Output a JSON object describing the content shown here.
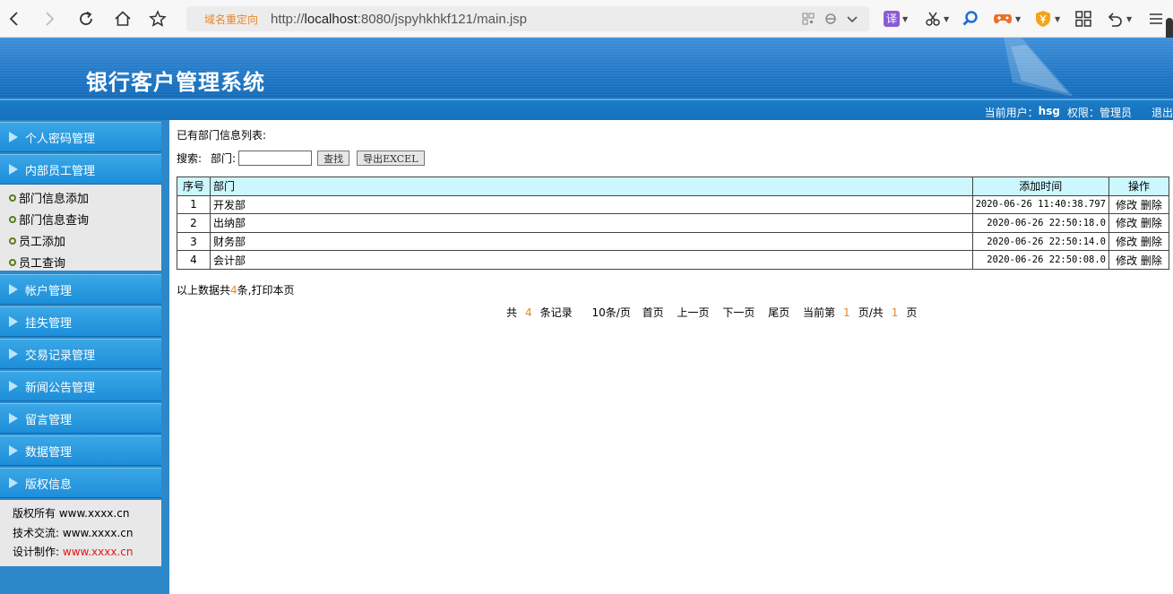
{
  "browser": {
    "redirect_label": "域名重定向",
    "url_prefix": "http://",
    "url_host": "localhost",
    "url_rest": ":8080/jspyhkhkf121/main.jsp",
    "translate_label": "译"
  },
  "header": {
    "title": "银行客户管理系统",
    "current_user_label": "当前用户：",
    "current_user": "hsg",
    "role_label": "权限：",
    "role": "管理员",
    "logout": "退出"
  },
  "sidebar": {
    "menus": [
      {
        "label": "个人密码管理"
      },
      {
        "label": "内部员工管理"
      },
      {
        "label": "帐户管理"
      },
      {
        "label": "挂失管理"
      },
      {
        "label": "交易记录管理"
      },
      {
        "label": "新闻公告管理"
      },
      {
        "label": "留言管理"
      },
      {
        "label": "数据管理"
      },
      {
        "label": "版权信息"
      }
    ],
    "submenu": [
      {
        "label": "部门信息添加"
      },
      {
        "label": "部门信息查询"
      },
      {
        "label": "员工添加"
      },
      {
        "label": "员工查询"
      }
    ],
    "footer": {
      "copyright_label": "版权所有",
      "copyright_value": "www.xxxx.cn",
      "tech_label": "技术交流:",
      "tech_value": "www.xxxx.cn",
      "design_label": "设计制作:",
      "design_value": "www.xxxx.cn"
    }
  },
  "main": {
    "list_title": "已有部门信息列表:",
    "search_label": "搜索:",
    "dept_label": "部门:",
    "dept_value": "",
    "search_button": "查找",
    "export_button": "导出EXCEL",
    "columns": {
      "no": "序号",
      "name": "部门",
      "time": "添加时间",
      "op": "操作"
    },
    "rows": [
      {
        "no": "1",
        "name": "开发部",
        "time": "2020-06-26 11:40:38.797",
        "edit": "修改",
        "del": "删除"
      },
      {
        "no": "2",
        "name": "出纳部",
        "time": "2020-06-26 22:50:18.0",
        "edit": "修改",
        "del": "删除"
      },
      {
        "no": "3",
        "name": "财务部",
        "time": "2020-06-26 22:50:14.0",
        "edit": "修改",
        "del": "删除"
      },
      {
        "no": "4",
        "name": "会计部",
        "time": "2020-06-26 22:50:08.0",
        "edit": "修改",
        "del": "删除"
      }
    ],
    "summary_prefix": "以上数据共",
    "summary_count": "4",
    "summary_suffix": "条,",
    "print_link": "打印本页",
    "pager": {
      "total_prefix": "共",
      "total_count": "4",
      "total_suffix": "条记录",
      "per_page": "10条/页",
      "first": "首页",
      "prev": "上一页",
      "next": "下一页",
      "last": "尾页",
      "current_prefix": "当前第",
      "current_page": "1",
      "current_mid": "页/共",
      "total_pages": "1",
      "current_suffix": "页"
    }
  }
}
